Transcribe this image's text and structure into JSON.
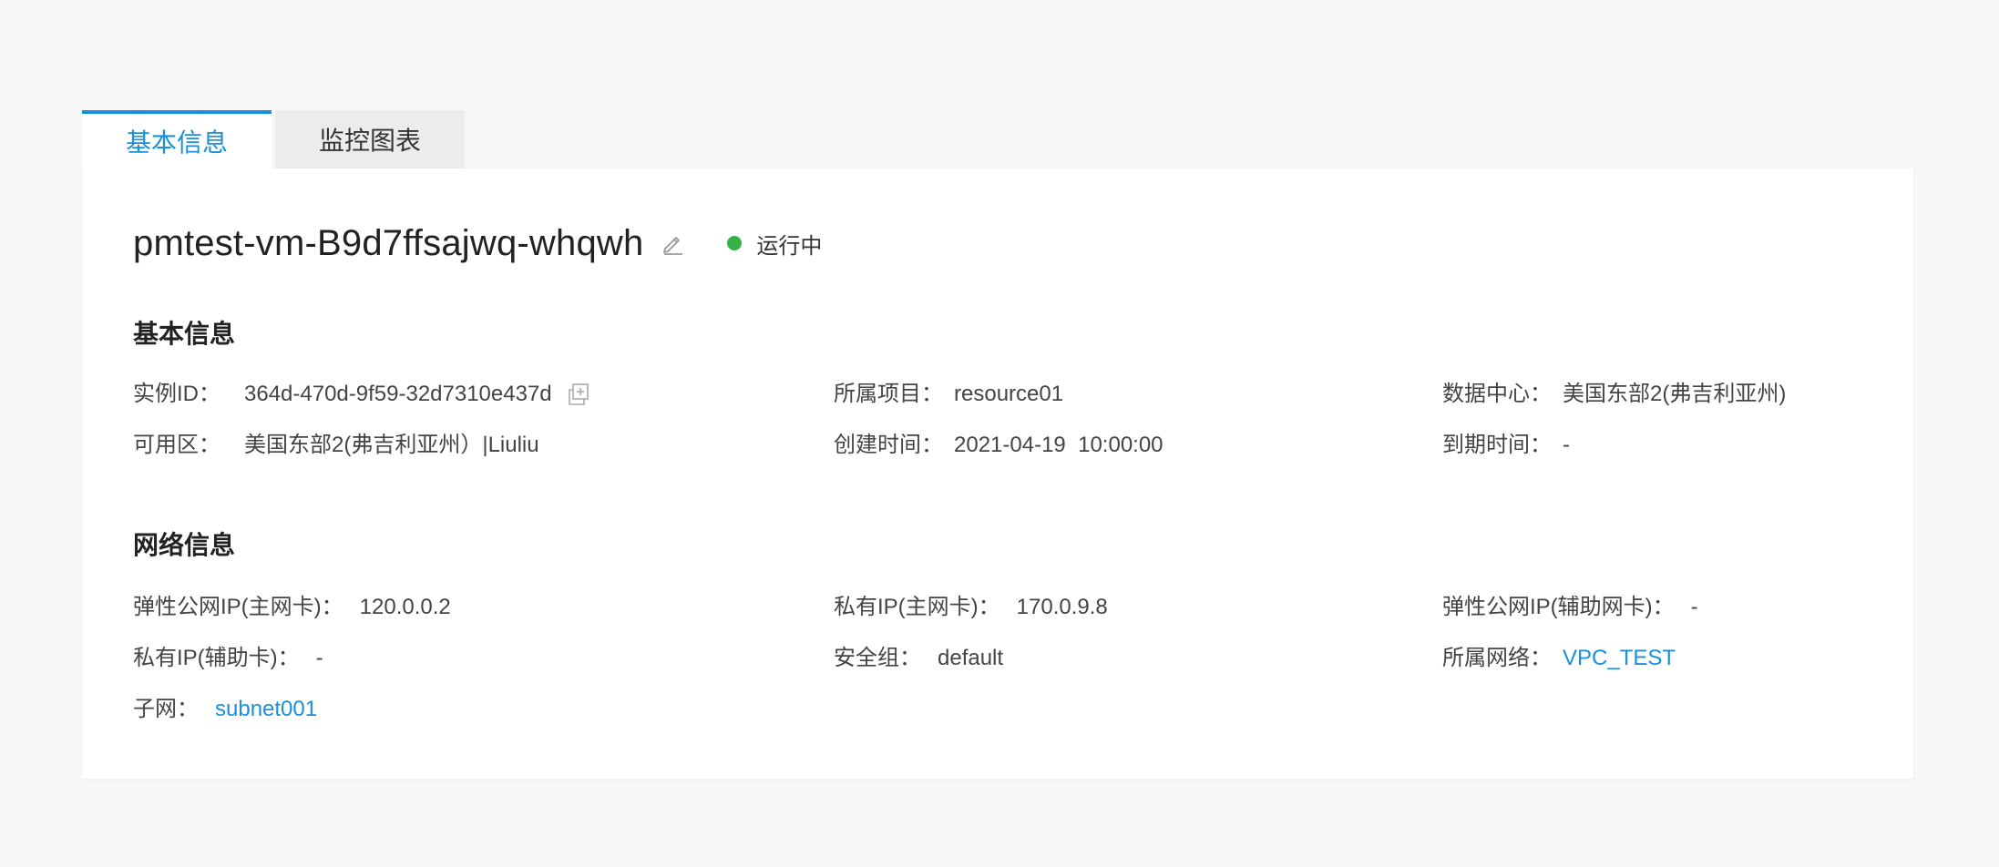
{
  "tabs": [
    {
      "label": "基本信息",
      "active": true
    },
    {
      "label": "监控图表",
      "active": false
    }
  ],
  "instance": {
    "name": "pmtest-vm-B9d7ffsajwq-whqwh",
    "status": "运行中",
    "status_color": "#35b34a"
  },
  "basic_info": {
    "title": "基本信息",
    "instance_id": {
      "label": "实例ID：",
      "value": "364d-470d-9f59-32d7310e437d"
    },
    "project": {
      "label": "所属项目：",
      "value": "resource01"
    },
    "datacenter": {
      "label": "数据中心：",
      "value": "美国东部2(弗吉利亚州)"
    },
    "zone": {
      "label": "可用区：",
      "value": "美国东部2(弗吉利亚州）|Liuliu"
    },
    "created": {
      "label": "创建时间：",
      "value": "2021-04-19  10:00:00"
    },
    "expire": {
      "label": "到期时间：",
      "value": "-"
    }
  },
  "network_info": {
    "title": "网络信息",
    "eip_primary": {
      "label": "弹性公网IP(主网卡)：",
      "value": "120.0.0.2"
    },
    "private_ip_primary": {
      "label": "私有IP(主网卡)：",
      "value": "170.0.9.8"
    },
    "eip_secondary": {
      "label": "弹性公网IP(辅助网卡)：",
      "value": "-"
    },
    "private_ip_secondary": {
      "label": "私有IP(辅助卡)：",
      "value": "-"
    },
    "security_group": {
      "label": "安全组：",
      "value": "default"
    },
    "vpc": {
      "label": "所属网络：",
      "value": "VPC_TEST"
    },
    "subnet": {
      "label": "子网：",
      "value": "subnet001"
    }
  },
  "colors": {
    "accent": "#1a8fdb",
    "background": "#f6f7f9",
    "panel": "#ffffff"
  },
  "icons": [
    "edit-icon",
    "copy-icon"
  ]
}
